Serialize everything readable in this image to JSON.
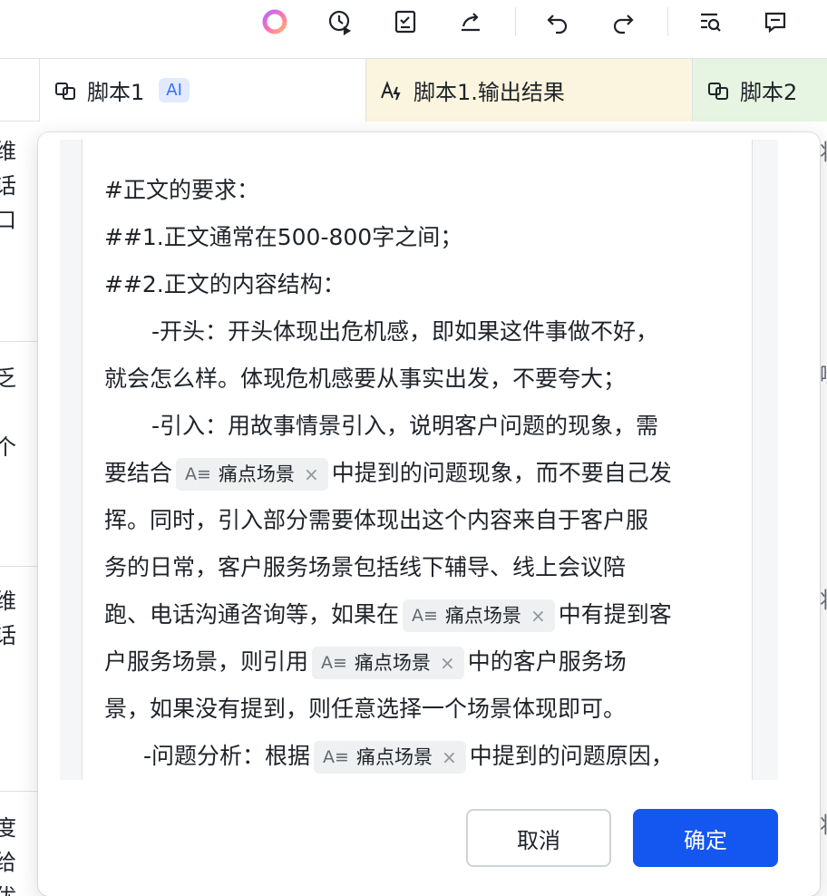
{
  "toolbar": {
    "icons": [
      "ai-assistant-icon",
      "history-icon",
      "task-check-icon",
      "share-icon",
      "undo-icon",
      "redo-icon",
      "find-icon",
      "comment-icon"
    ]
  },
  "table": {
    "columns": [
      {
        "label": "",
        "icon": ""
      },
      {
        "label": "脚本1",
        "icon": "script-icon",
        "badge": "AI"
      },
      {
        "label": "脚本1.输出结果",
        "icon": "text-ai-icon"
      },
      {
        "label": "脚本2",
        "icon": "script-icon"
      }
    ],
    "left_fragments": [
      "维",
      "话",
      "口",
      "乏",
      "个",
      "维",
      "话",
      "度",
      "给",
      "优"
    ],
    "right_fragments": [
      "将",
      "哟",
      "将",
      "将"
    ]
  },
  "modal": {
    "editor": {
      "lines": [
        {
          "indent": 0,
          "parts": [
            {
              "t": "#正文的要求："
            }
          ]
        },
        {
          "indent": 0,
          "parts": [
            {
              "t": "##1.正文通常在500-800字之间；"
            }
          ]
        },
        {
          "indent": 0,
          "parts": [
            {
              "t": "##2.正文的内容结构："
            }
          ]
        },
        {
          "indent": 1,
          "parts": [
            {
              "t": "-开头：开头体现出危机感，即如果这件事做不好，"
            }
          ]
        },
        {
          "indent": 0,
          "parts": [
            {
              "t": "就会怎么样。体现危机感要从事实出发，不要夸大；"
            }
          ]
        },
        {
          "indent": 1,
          "parts": [
            {
              "t": "-引入：用故事情景引入，说明客户问题的现象，需"
            }
          ]
        },
        {
          "indent": 0,
          "parts": [
            {
              "t": "要结合"
            },
            {
              "chip": "痛点场景"
            },
            {
              "t": "中提到的问题现象，而不要自己发"
            }
          ]
        },
        {
          "indent": 0,
          "parts": [
            {
              "t": "挥。同时，引入部分需要体现出这个内容来自于客户服"
            }
          ]
        },
        {
          "indent": 0,
          "parts": [
            {
              "t": "务的日常，客户服务场景包括线下辅导、线上会议陪"
            }
          ]
        },
        {
          "indent": 0,
          "parts": [
            {
              "t": "跑、电话沟通咨询等，如果在"
            },
            {
              "chip": "痛点场景"
            },
            {
              "t": "中有提到客"
            }
          ]
        },
        {
          "indent": 0,
          "parts": [
            {
              "t": "户服务场景，则引用"
            },
            {
              "chip": "痛点场景"
            },
            {
              "t": "中的客户服务场"
            }
          ]
        },
        {
          "indent": 0,
          "parts": [
            {
              "t": "景，如果没有提到，则任意选择一个场景体现即可。"
            }
          ]
        },
        {
          "indent": 2,
          "parts": [
            {
              "t": "-问题分析：根据"
            },
            {
              "chip": "痛点场景"
            },
            {
              "t": "中提到的问题原因，"
            }
          ]
        }
      ],
      "chip_icon": "A≡",
      "chip_close": "×"
    },
    "cancel_label": "取消",
    "confirm_label": "确定"
  }
}
